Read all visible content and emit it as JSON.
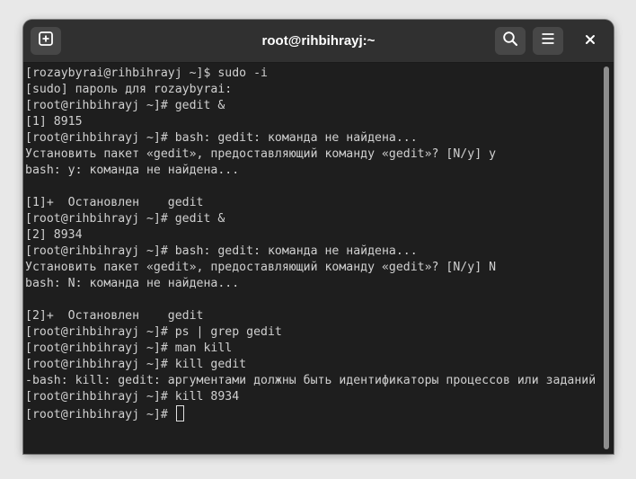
{
  "window": {
    "title": "root@rihbihrayj:~"
  },
  "header": {
    "new_tab_icon": "new-tab-icon",
    "search_icon": "search-icon",
    "menu_icon": "hamburger-menu-icon",
    "close_icon": "close-icon"
  },
  "terminal": {
    "lines": [
      "[rozaybyrai@rihbihrayj ~]$ sudo -i",
      "[sudo] пароль для rozaybyrai:",
      "[root@rihbihrayj ~]# gedit &",
      "[1] 8915",
      "[root@rihbihrayj ~]# bash: gedit: команда не найдена...",
      "Установить пакет «gedit», предоставляющий команду «gedit»? [N/y] y",
      "bash: y: команда не найдена...",
      "",
      "[1]+  Остановлен    gedit",
      "[root@rihbihrayj ~]# gedit &",
      "[2] 8934",
      "[root@rihbihrayj ~]# bash: gedit: команда не найдена...",
      "Установить пакет «gedit», предоставляющий команду «gedit»? [N/y] N",
      "bash: N: команда не найдена...",
      "",
      "[2]+  Остановлен    gedit",
      "[root@rihbihrayj ~]# ps | grep gedit",
      "[root@rihbihrayj ~]# man kill",
      "[root@rihbihrayj ~]# kill gedit",
      "-bash: kill: gedit: аргументами должны быть идентификаторы процессов или заданий",
      "[root@rihbihrayj ~]# kill 8934"
    ],
    "prompt": "[root@rihbihrayj ~]# "
  },
  "colors": {
    "background": "#1e1e1e",
    "headerbar": "#303030",
    "text": "#d0d0d0"
  }
}
